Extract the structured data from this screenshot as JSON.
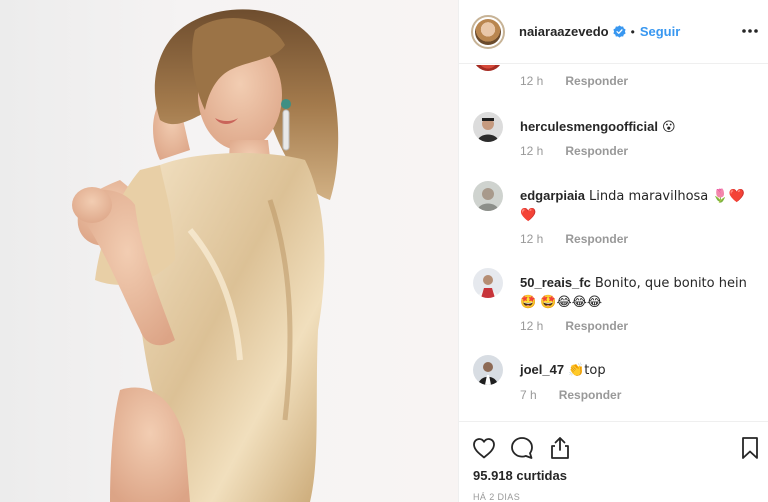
{
  "post": {
    "image_alt": "Woman in a gold satin dress posing against a light backdrop"
  },
  "header": {
    "username": "naiaraazevedo",
    "separator": "•",
    "follow_label": "Seguir"
  },
  "partial_comment": {
    "time": "12 h",
    "reply_label": "Responder"
  },
  "comments": [
    {
      "user": "herculesmengoofficial",
      "text": "😮",
      "time": "12 h",
      "reply_label": "Responder"
    },
    {
      "user": "edgarpiaia",
      "text": "Linda maravilhosa 🌷❤️ ❤️",
      "time": "12 h",
      "reply_label": "Responder"
    },
    {
      "user": "50_reais_fc",
      "text": "Bonito, que bonito hein🤩 🤩😂😂😂",
      "time": "12 h",
      "reply_label": "Responder"
    },
    {
      "user": "joel_47",
      "text": "👏top",
      "time": "7 h",
      "reply_label": "Responder"
    }
  ],
  "footer": {
    "likes": "95.918 curtidas",
    "posted": "HÁ 2 DIAS"
  },
  "colors": {
    "follow": "#3897f0",
    "verified": "#3897f0",
    "meta": "#999999",
    "border": "#efefef"
  }
}
